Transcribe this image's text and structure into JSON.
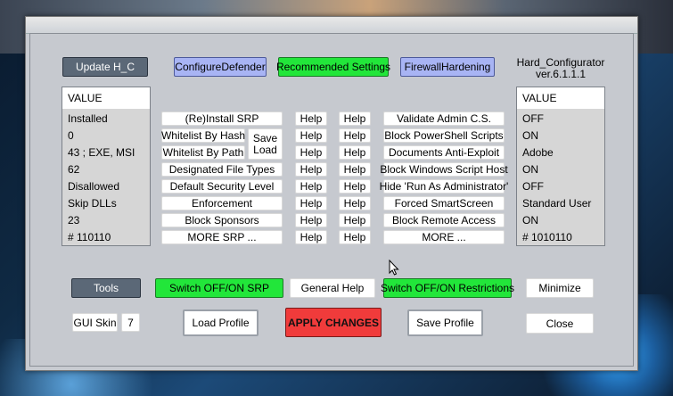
{
  "app": {
    "name": "Hard_Configurator",
    "version": "ver.6.1.1.1"
  },
  "top_buttons": {
    "update": "Update H_C",
    "configure_defender": "ConfigureDefender",
    "recommended": "Recommended Settings",
    "firewall": "FirewallHardening"
  },
  "left_panel": {
    "header": "VALUE",
    "rows": [
      "Installed",
      "0",
      "43 ;  EXE, MSI",
      "62",
      "Disallowed",
      "Skip DLLs",
      "23",
      "# 110110"
    ]
  },
  "right_panel": {
    "header": "VALUE",
    "rows": [
      "OFF",
      "ON",
      "Adobe",
      "ON",
      "OFF",
      "Standard User",
      "ON",
      "# 1010110"
    ]
  },
  "srp_buttons": [
    "(Re)Install SRP",
    "Whitelist By Hash",
    "Whitelist By Path",
    "Designated File Types",
    "Default Security Level",
    "Enforcement",
    "Block Sponsors",
    "MORE SRP ..."
  ],
  "save_load": {
    "save": "Save",
    "load": "Load"
  },
  "help_label": "Help",
  "restriction_buttons": [
    "Validate Admin C.S.",
    "Block PowerShell Scripts",
    "Documents Anti-Exploit",
    "Block Windows Script Host",
    "Hide  'Run As Administrator'",
    "Forced SmartScreen",
    "Block Remote Access",
    "MORE ..."
  ],
  "bottom": {
    "tools": "Tools",
    "switch_srp": "Switch OFF/ON SRP",
    "general_help": "General Help",
    "switch_restrictions": "Switch OFF/ON Restrictions",
    "minimize": "Minimize",
    "gui_skin": "GUI Skin",
    "skin_number": "7",
    "load_profile": "Load Profile",
    "apply": "APPLY CHANGES",
    "save_profile": "Save Profile",
    "close": "Close"
  },
  "colors": {
    "green": "#22e63a",
    "blue": "#a8b4f4",
    "red": "#f03b3b",
    "dark": "#5b6877",
    "window": "#c6c9cf"
  }
}
